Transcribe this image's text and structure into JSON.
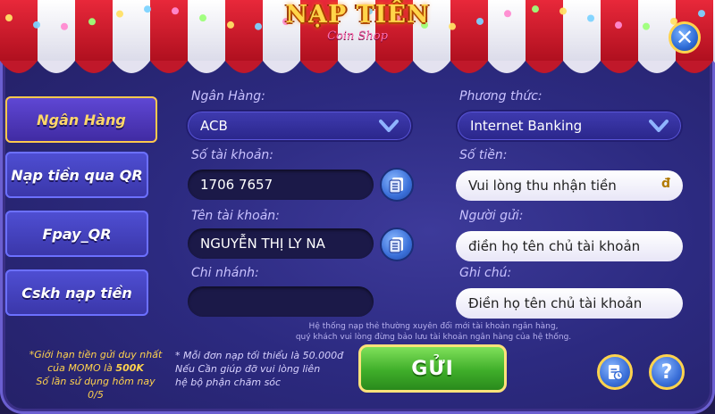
{
  "header": {
    "title": "NẠP TIỀN",
    "subtitle": "Coin Shop"
  },
  "sidebar": {
    "items": [
      {
        "label": "Ngân Hàng",
        "active": true
      },
      {
        "label": "Nạp tiền qua QR"
      },
      {
        "label": "Fpay_QR"
      },
      {
        "label": "Cskh nạp tiền"
      }
    ]
  },
  "form": {
    "bank_label": "Ngân Hàng:",
    "bank_value": "ACB",
    "method_label": "Phương thức:",
    "method_value": "Internet Banking",
    "account_no_label": "Số tài khoản:",
    "account_no_value": "1706 7657",
    "amount_label": "Số tiền:",
    "amount_placeholder": "Vui lòng thu nhận tiền",
    "currency_symbol": "đ",
    "account_name_label": "Tên tài khoản:",
    "account_name_value": "NGUYỄN THỊ LY NA",
    "sender_label": "Người gửi:",
    "sender_placeholder": "điền họ tên chủ tài khoản",
    "branch_label": "Chi nhánh:",
    "branch_value": "",
    "memo_label": "Ghi chú:",
    "memo_placeholder": "Điền họ tên chủ tài khoản"
  },
  "notice": {
    "line1": "Hệ thống nạp thẻ thường xuyên đổi mới tài khoản ngân hàng,",
    "line2": "quý khách vui lòng đừng bảo lưu tài khoản ngân hàng của hệ thống."
  },
  "limit": {
    "line1": "*Giới hạn tiền gửi duy nhất",
    "line2_prefix": "của MOMO là",
    "line2_value": "500K",
    "line3": "Số lần sử dụng hôm nay",
    "line4": "0/5"
  },
  "warning": {
    "line1": "* Mỗi đơn nạp tối thiểu là 50.000đ",
    "line2": "Nếu Cần giúp đỡ vui lòng liên",
    "line3": "hệ bộ phận chăm sóc"
  },
  "actions": {
    "send_label": "GỬI",
    "help_label": "?"
  },
  "icons": {
    "close": "close-icon",
    "copy": "copy-icon",
    "chevron": "chevron-down-icon",
    "history": "history-icon",
    "help": "help-icon"
  },
  "colors": {
    "accent_gold": "#ffd24d",
    "panel_blue": "#2c2a80",
    "send_green": "#3fae2a"
  }
}
